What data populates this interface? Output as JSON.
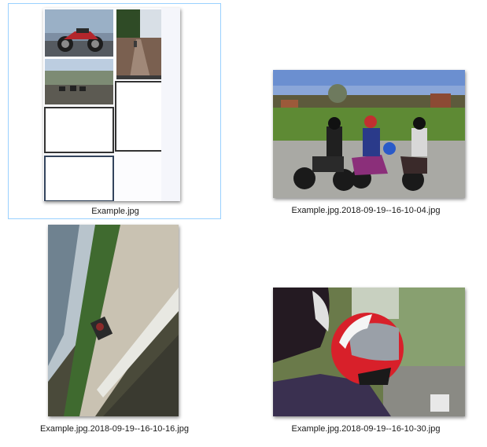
{
  "view": "file-explorer-large-icons",
  "colors": {
    "selection_border": "#99d1ff",
    "label_text": "#1a1a1a",
    "background": "#ffffff"
  },
  "files": [
    {
      "name": "Example.jpg",
      "selected": true,
      "thumbnail": "scanned-page-with-photo-collage"
    },
    {
      "name": "Example.jpg.2018-09-19--16-10-04.jpg",
      "selected": false,
      "thumbnail": "three-motorcyclists-photo"
    },
    {
      "name": "Example.jpg.2018-09-19--16-10-16.jpg",
      "selected": false,
      "thumbnail": "rider-on-bank-rotated-photo"
    },
    {
      "name": "Example.jpg.2018-09-19--16-10-30.jpg",
      "selected": false,
      "thumbnail": "red-helmet-rider-photo"
    }
  ]
}
